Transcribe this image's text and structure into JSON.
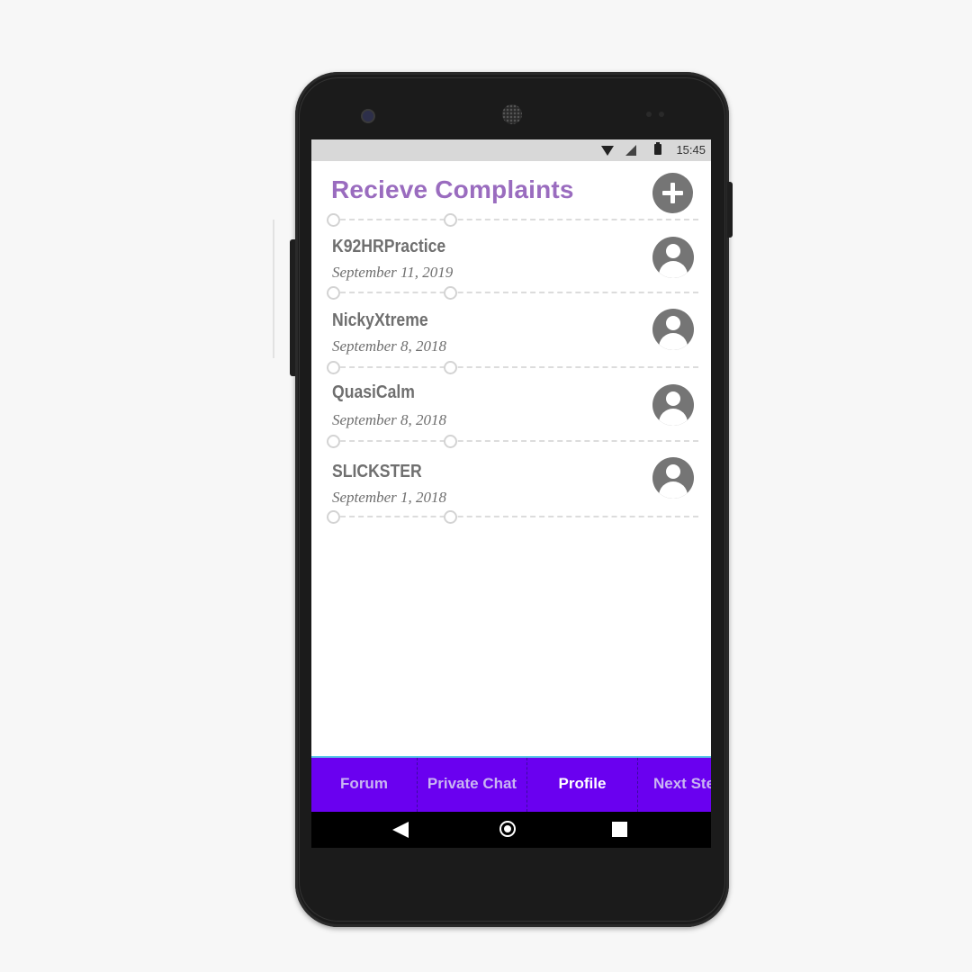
{
  "status_bar": {
    "time": "15:45"
  },
  "header": {
    "title": "Recieve Complaints",
    "add_icon": "plus-circle-icon"
  },
  "complaints": [
    {
      "name": "K92HRPractice",
      "date": "September 11, 2019",
      "avatar_icon": "account-circle-icon"
    },
    {
      "name": "NickyXtreme",
      "date": "September 8, 2018",
      "avatar_icon": "account-circle-icon"
    },
    {
      "name": "QuasiCalm",
      "date": "September 8, 2018",
      "avatar_icon": "account-circle-icon"
    },
    {
      "name": "SLICKSTER",
      "date": "September 1, 2018",
      "avatar_icon": "account-circle-icon"
    }
  ],
  "bottom_nav": {
    "tabs": [
      {
        "label": "Forum"
      },
      {
        "label": "Private Chat"
      },
      {
        "label": "Profile"
      },
      {
        "label": "Next Ste"
      }
    ],
    "active": "Profile",
    "background_color": "#6a00f0"
  },
  "system_nav": {
    "back_icon": "back-triangle-icon",
    "home_icon": "home-circle-icon",
    "recents_icon": "recents-square-icon"
  },
  "colors": {
    "title": "#9a6cbf",
    "icon_gray": "#757575",
    "text_gray": "#6f6f6f"
  }
}
